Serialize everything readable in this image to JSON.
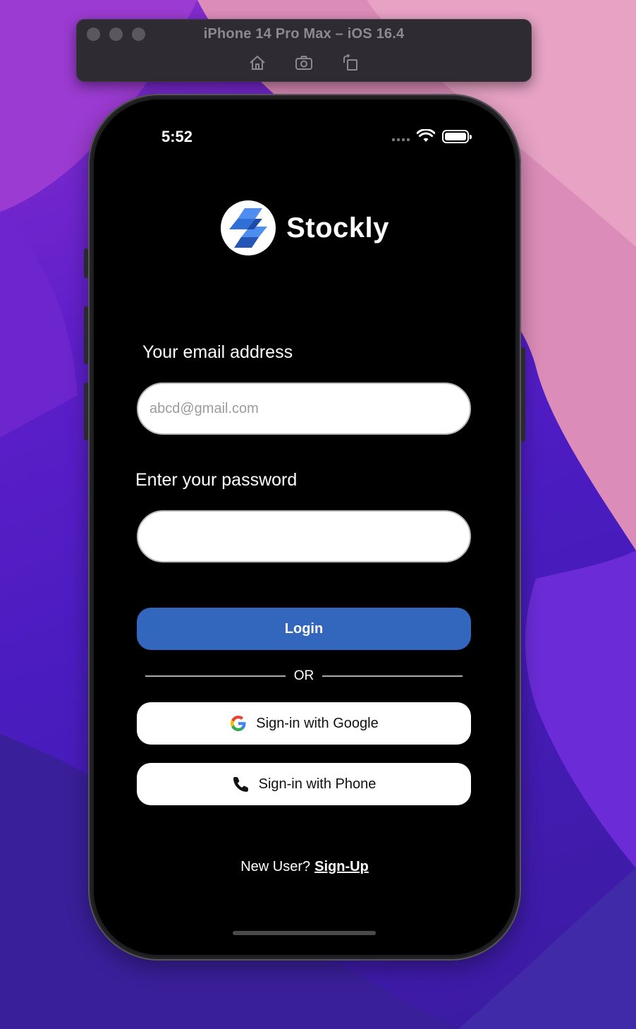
{
  "simulator": {
    "title": "iPhone 14 Pro Max – iOS 16.4",
    "tools": [
      "home-icon",
      "screenshot-icon",
      "rotate-icon"
    ]
  },
  "status_bar": {
    "time": "5:52"
  },
  "brand": {
    "name": "Stockly",
    "logo_color": "#3a7be0"
  },
  "form": {
    "email_label": "Your email address",
    "email_placeholder": "abcd@gmail.com",
    "email_value": "",
    "password_label": "Enter your password",
    "password_value": "",
    "login_label": "Login"
  },
  "divider": {
    "text": "OR"
  },
  "social": {
    "google_label": "Sign-in with Google",
    "phone_label": "Sign-in with Phone"
  },
  "footer": {
    "prompt": "New User?",
    "signup_link": "Sign-Up"
  },
  "colors": {
    "primary": "#3267bd",
    "screen_bg": "#000000"
  }
}
